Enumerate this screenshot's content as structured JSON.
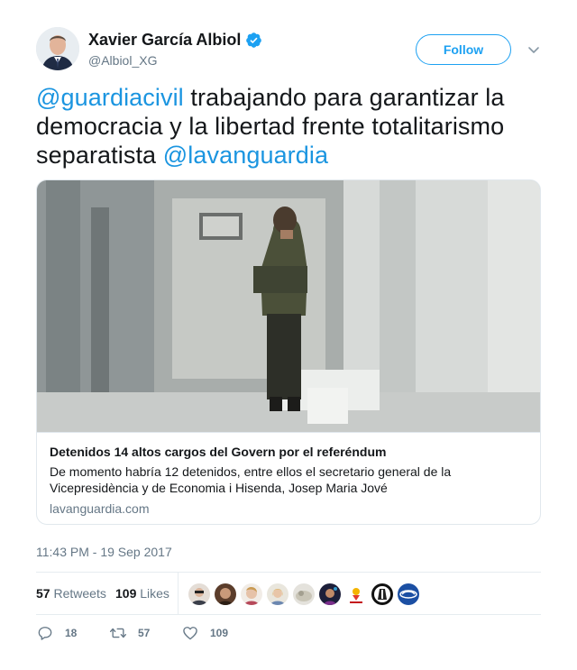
{
  "author": {
    "name": "Xavier García Albiol",
    "handle": "@Albiol_XG"
  },
  "follow_label": "Follow",
  "tweet": {
    "mention1": "@guardiacivil",
    "body": " trabajando para garantizar la democracia y la libertad frente totalitarismo separatista ",
    "mention2": "@lavanguardia"
  },
  "card": {
    "title": "Detenidos 14 altos cargos del Govern por el referéndum",
    "description": "De momento habría 12 detenidos, entre ellos el secretario general de la Vicepresidència y de Economia i Hisenda, Josep Maria Jové",
    "domain": "lavanguardia.com"
  },
  "timestamp": "11:43 PM - 19 Sep 2017",
  "stats": {
    "retweets_count": "57",
    "retweets_label": "Retweets",
    "likes_count": "109",
    "likes_label": "Likes"
  },
  "actions": {
    "reply_count": "18",
    "retweet_count": "57",
    "like_count": "109"
  },
  "colors": {
    "link": "#1b95e0",
    "follow": "#1da1f2",
    "muted": "#657786",
    "border": "#e1e8ed"
  },
  "icons": [
    "verified-badge-icon",
    "chevron-down-icon",
    "reply-icon",
    "retweet-icon",
    "heart-icon"
  ]
}
